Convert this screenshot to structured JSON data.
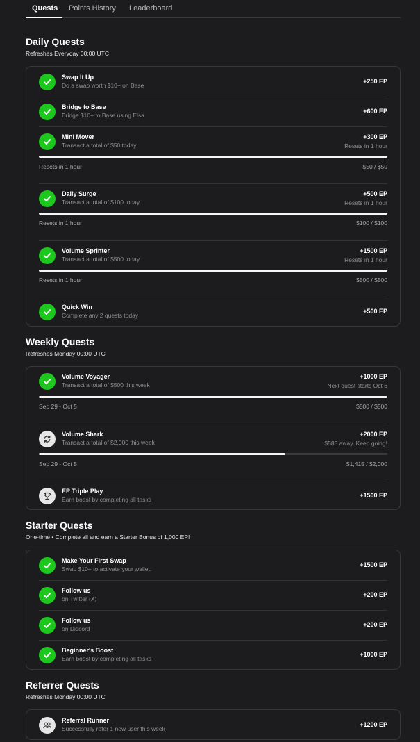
{
  "tabs": [
    {
      "label": "Quests"
    },
    {
      "label": "Points History"
    },
    {
      "label": "Leaderboard"
    }
  ],
  "daily": {
    "title": "Daily Quests",
    "subtitle": "Refreshes Everyday 00:00 UTC",
    "quests": [
      {
        "title": "Swap It Up",
        "desc": "Do a swap worth $10+ on Base",
        "points": "+250 EP"
      },
      {
        "title": "Bridge to Base",
        "desc": "Bridge $10+ to Base using Elsa",
        "points": "+600 EP"
      },
      {
        "title": "Mini Mover",
        "desc": "Transact a total of $50 today",
        "points": "+300 EP",
        "note": "Resets in 1 hour",
        "bar_left": "Resets in 1 hour",
        "bar_right": "$50 / $50",
        "progress": 1.0
      },
      {
        "title": "Daily Surge",
        "desc": "Transact a total of $100 today",
        "points": "+500 EP",
        "note": "Resets in 1 hour",
        "bar_left": "Resets in 1 hour",
        "bar_right": "$100 / $100",
        "progress": 1.0
      },
      {
        "title": "Volume Sprinter",
        "desc": "Transact a total of $500 today",
        "points": "+1500 EP",
        "note": "Resets in 1 hour",
        "bar_left": "Resets in 1 hour",
        "bar_right": "$500 / $500",
        "progress": 1.0
      },
      {
        "title": "Quick Win",
        "desc": "Complete any 2 quests today",
        "points": "+500 EP"
      }
    ]
  },
  "weekly": {
    "title": "Weekly Quests",
    "subtitle": "Refreshes Monday 00:00 UTC",
    "quests": [
      {
        "title": "Volume Voyager",
        "desc": "Transact a total of $500 this week",
        "points": "+1000 EP",
        "note": "Next quest starts Oct 6",
        "bar_left": "Sep 29 - Oct 5",
        "bar_right": "$500 / $500",
        "progress": 1.0,
        "icon": "check-icon"
      },
      {
        "title": "Volume Shark",
        "desc": "Transact a total of $2,000 this week",
        "points": "+2000 EP",
        "note": "$585 away. Keep going!",
        "bar_left": "Sep 29 - Oct 5",
        "bar_right": "$1,415 / $2,000",
        "progress": 0.7075,
        "icon": "refresh-icon"
      },
      {
        "title": "EP Triple Play",
        "desc": "Earn boost by completing all tasks",
        "points": "+1500 EP",
        "icon": "trophy-icon"
      }
    ]
  },
  "starter": {
    "title": "Starter Quests",
    "subtitle": "One-time • Complete all and earn a Starter Bonus of 1,000 EP!",
    "quests": [
      {
        "title": "Make Your First Swap",
        "desc": "Swap $10+ to activate your wallet.",
        "points": "+1500 EP"
      },
      {
        "title": "Follow us",
        "desc": "on Twitter (X)",
        "points": "+200 EP"
      },
      {
        "title": "Follow us",
        "desc": "on Discord",
        "points": "+200 EP"
      },
      {
        "title": "Beginner's Boost",
        "desc": "Earn boost by completing all tasks",
        "points": "+1000 EP"
      }
    ]
  },
  "referrer": {
    "title": "Referrer Quests",
    "subtitle": "Refreshes Monday 00:00 UTC",
    "quests": [
      {
        "title": "Referral Runner",
        "desc": "Successfully refer 1 new user this week",
        "points": "+1200 EP",
        "icon": "people-icon"
      }
    ]
  },
  "colors": {
    "background": "#1c1c1e",
    "complete_green": "#1ec71e",
    "progress_fill": "#f5f5f5",
    "progress_track": "#3a3a3d"
  }
}
